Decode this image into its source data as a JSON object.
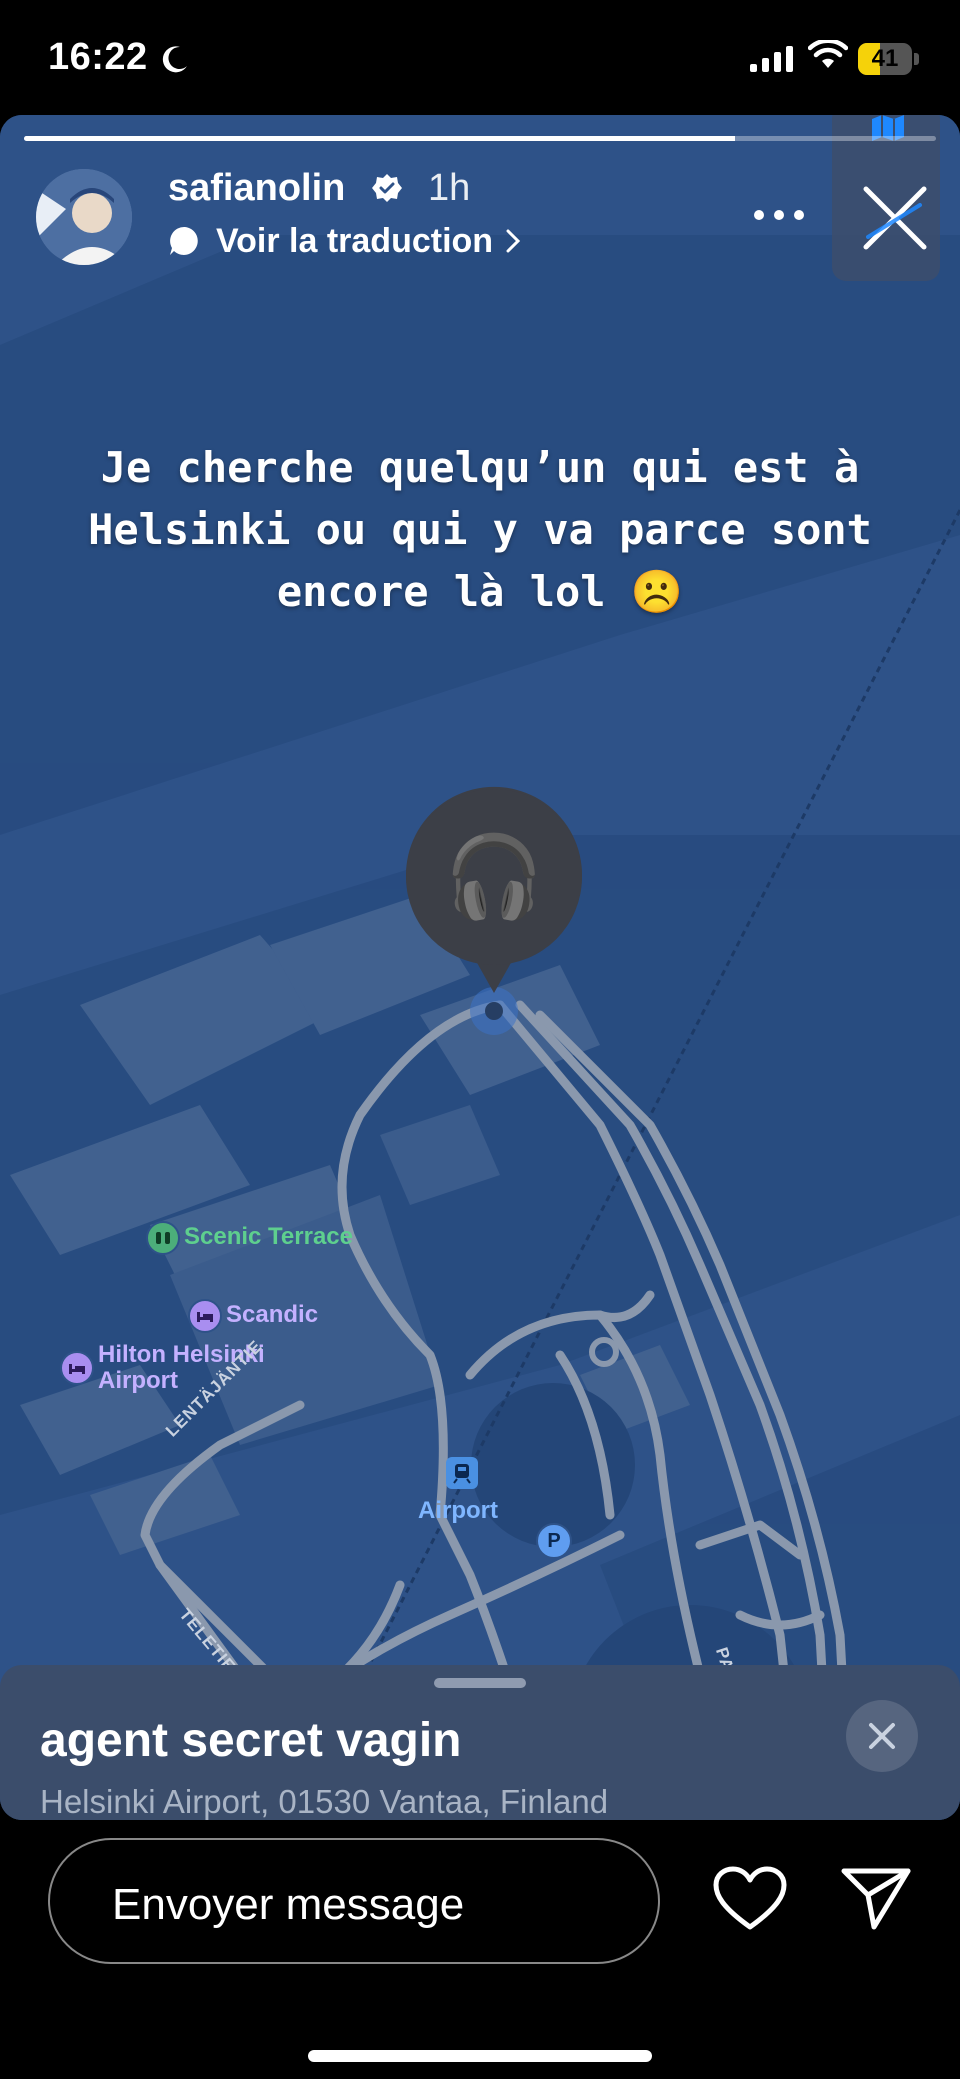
{
  "status_bar": {
    "time": "16:22",
    "battery": "41",
    "battery_level": 0.41
  },
  "story": {
    "progress": 0.78,
    "username": "safianolin",
    "time_ago": "1h",
    "translate_label": "Voir la traduction",
    "caption": "Je cherche quelqu’un qui est à Helsinki ou qui y va parce sont encore là lol ☹️"
  },
  "map": {
    "pin_emoji": "🎧",
    "labels": {
      "scenic_terrace": "Scenic Terrace",
      "scandic": "Scandic",
      "hilton_line1": "Hilton Helsinki",
      "hilton_line2": "Airport",
      "airport_station": "Airport",
      "parking": "P"
    },
    "roads": {
      "lentajantie": "LENTÄJÄNTIE",
      "teletie": "TELETIE",
      "parkkitie": "PARKKITIE"
    }
  },
  "location_sheet": {
    "title": "agent secret vagin",
    "address": "Helsinki Airport, 01530 Vantaa, Finland"
  },
  "reply": {
    "placeholder": "Envoyer message"
  },
  "colors": {
    "map_base": "#2e5288",
    "road": "#8a98ad",
    "green_poi": "#4cae7a",
    "purple_poi": "#a98ef0",
    "transit": "#4a90e2"
  },
  "icons": [
    "moon-icon",
    "signal-icon",
    "wifi-icon",
    "verified-icon",
    "translate-bubble-icon",
    "more-icon",
    "map-icon",
    "close-icon",
    "earbuds-pin",
    "heart-icon",
    "send-icon"
  ]
}
